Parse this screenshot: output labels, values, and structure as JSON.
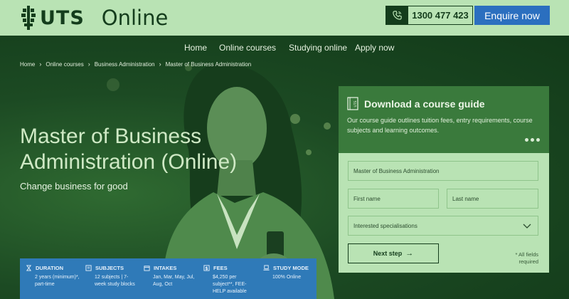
{
  "header": {
    "logo_text": "UTS",
    "brand_suffix": "Online",
    "phone": "1300 477 423",
    "enquire_label": "Enquire now"
  },
  "nav": {
    "items": [
      "Home",
      "Online courses",
      "Studying online",
      "Apply now"
    ]
  },
  "breadcrumb": [
    "Home",
    "Online courses",
    "Business Administration",
    "Master of Business Administration"
  ],
  "hero": {
    "title_line1": "Master of Business",
    "title_line2": "Administration (Online)",
    "subtitle": "Change business for good"
  },
  "info_bar": [
    {
      "label": "DURATION",
      "icon": "hourglass-icon",
      "value": "2 years (minimum)*, part-time"
    },
    {
      "label": "SUBJECTS",
      "icon": "book-icon",
      "value": "12 subjects | 7-week study blocks"
    },
    {
      "label": "INTAKES",
      "icon": "calendar-icon",
      "value": "Jan, Mar, May, Jul, Aug, Oct"
    },
    {
      "label": "FEES",
      "icon": "dollar-icon",
      "value": "$4,250 per subject**, FEE-HELP available"
    },
    {
      "label": "STUDY MODE",
      "icon": "laptop-icon",
      "value": "100% Online"
    }
  ],
  "guide": {
    "title": "Download a course guide",
    "description": "Our course guide outlines tuition fees, entry requirements, course subjects and learning outcomes.",
    "icon": "uts-book-icon"
  },
  "form": {
    "course_value": "Master of Business Administration",
    "first_name_placeholder": "First name",
    "last_name_placeholder": "Last name",
    "specialisation_placeholder": "Interested specialisations",
    "next_label": "Next step",
    "required_note": "* All fields required"
  },
  "colors": {
    "header_bg": "#b9e3b4",
    "dark_green": "#143d1c",
    "enquire_blue": "#2b6fbf",
    "info_bar_blue": "#2f7ab8",
    "guide_green": "#3a7a3c"
  }
}
